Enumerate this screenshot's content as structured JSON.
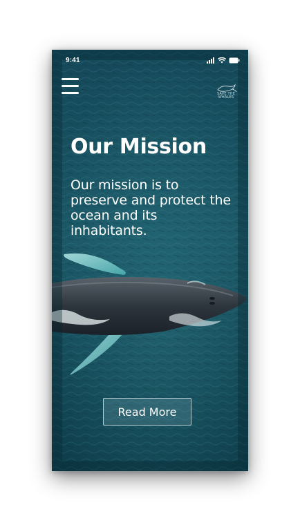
{
  "status_bar": {
    "time": "9:41",
    "icons": [
      "cellular-signal-icon",
      "wifi-icon",
      "battery-icon"
    ]
  },
  "header": {
    "menu_icon": "hamburger-menu-icon",
    "logo": {
      "icon": "whale-logo-icon",
      "lines": [
        "SAVE THE",
        "WHALES"
      ]
    }
  },
  "hero": {
    "title": "Our Mission",
    "description": "Our mission is to preserve and protect the ocean and its inhabitants.",
    "background": "humpback-whale-ocean-photo"
  },
  "cta": {
    "read_more_label": "Read More"
  },
  "colors": {
    "ocean_dark": "#0f3f4c",
    "ocean_mid": "#1d5e6c",
    "text": "#ffffff",
    "whale_fin": "#8fd6d6"
  }
}
